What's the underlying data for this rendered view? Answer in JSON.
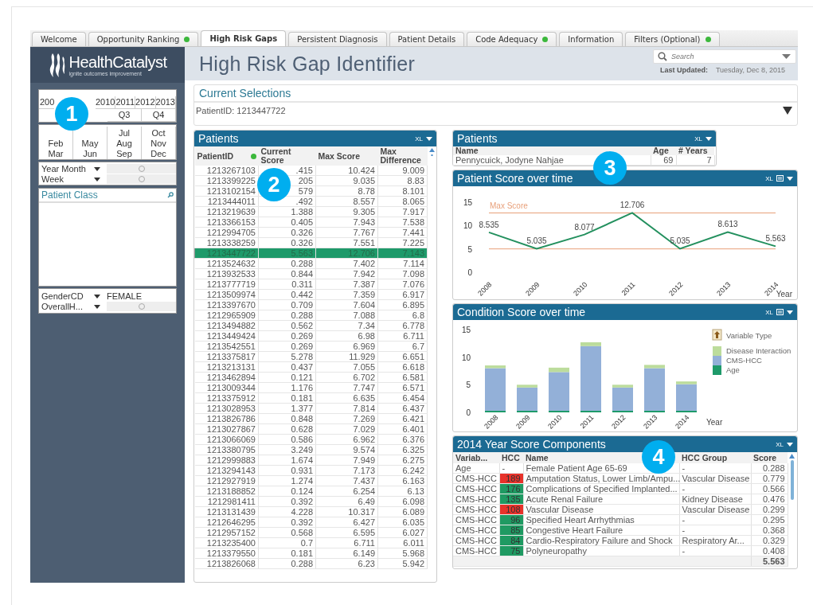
{
  "tabs": [
    {
      "label": "Welcome",
      "selected": false,
      "indicator": false
    },
    {
      "label": "Opportunity Ranking",
      "selected": false,
      "indicator": true
    },
    {
      "label": "High Risk Gaps",
      "selected": true,
      "indicator": false
    },
    {
      "label": "Persistent Diagnosis",
      "selected": false,
      "indicator": false
    },
    {
      "label": "Patient Details",
      "selected": false,
      "indicator": false
    },
    {
      "label": "Code Adequacy",
      "selected": false,
      "indicator": true
    },
    {
      "label": "Information",
      "selected": false,
      "indicator": false
    },
    {
      "label": "Filters (Optional)",
      "selected": false,
      "indicator": true
    }
  ],
  "logo": {
    "name": "HealthCatalyst",
    "tagline": "ignite outcomes improvement"
  },
  "date_filter": {
    "years": [
      "200",
      "2010",
      "2011",
      "2012",
      "2013"
    ],
    "quarters": [
      "Q3",
      "Q4"
    ],
    "month_columns": [
      [
        "Feb",
        "Mar"
      ],
      [
        "May",
        "Jun"
      ],
      [
        "Jul",
        "Aug",
        "Sep"
      ],
      [
        "Oct",
        "Nov",
        "Dec"
      ]
    ]
  },
  "period_fields": [
    {
      "label": "Year Month"
    },
    {
      "label": "Week"
    }
  ],
  "patient_class": {
    "title": "Patient Class"
  },
  "demographic_fields": [
    {
      "label": "GenderCD",
      "value": "FEMALE"
    },
    {
      "label": "OverallH..."
    }
  ],
  "page_title": "High Risk Gap Identifier",
  "search": {
    "placeholder": "Search"
  },
  "last_updated": {
    "label": "Last Updated:",
    "value": "Tuesday, Dec 8, 2015"
  },
  "current_selections": {
    "title": "Current Selections",
    "text": "PatientID: 1213447722"
  },
  "patients_table": {
    "title": "Patients",
    "export": "XL",
    "columns": [
      "PatientID",
      "Current Score",
      "Max Score",
      "Max Difference"
    ],
    "rows": [
      {
        "cells": [
          "1213267103",
          ".415",
          "10.424",
          "9.009"
        ],
        "selected": false
      },
      {
        "cells": [
          "1213399225",
          "205",
          "9.035",
          "8.83"
        ],
        "selected": false
      },
      {
        "cells": [
          "1213102154",
          "579",
          "8.78",
          "8.101"
        ],
        "selected": false
      },
      {
        "cells": [
          "1213444011",
          ".492",
          "8.557",
          "8.065"
        ],
        "selected": false
      },
      {
        "cells": [
          "1213219639",
          "1.388",
          "9.305",
          "7.917"
        ],
        "selected": false
      },
      {
        "cells": [
          "1213366153",
          "0.405",
          "7.943",
          "7.538"
        ],
        "selected": false
      },
      {
        "cells": [
          "1212994705",
          "0.326",
          "7.767",
          "7.441"
        ],
        "selected": false
      },
      {
        "cells": [
          "1213338259",
          "0.326",
          "7.551",
          "7.225"
        ],
        "selected": false
      },
      {
        "cells": [
          "1213447722",
          "5.563",
          "12.706",
          "7.143"
        ],
        "selected": true
      },
      {
        "cells": [
          "1213524632",
          "0.288",
          "7.402",
          "7.114"
        ],
        "selected": false
      },
      {
        "cells": [
          "1213932533",
          "0.844",
          "7.942",
          "7.098"
        ],
        "selected": false
      },
      {
        "cells": [
          "1213777719",
          "0.311",
          "7.387",
          "7.076"
        ],
        "selected": false
      },
      {
        "cells": [
          "1213509974",
          "0.442",
          "7.359",
          "6.917"
        ],
        "selected": false
      },
      {
        "cells": [
          "1213397670",
          "0.709",
          "7.604",
          "6.895"
        ],
        "selected": false
      },
      {
        "cells": [
          "1212965909",
          "0.288",
          "7.088",
          "6.8"
        ],
        "selected": false
      },
      {
        "cells": [
          "1213494882",
          "0.562",
          "7.34",
          "6.778"
        ],
        "selected": false
      },
      {
        "cells": [
          "1213449424",
          "0.269",
          "6.98",
          "6.711"
        ],
        "selected": false
      },
      {
        "cells": [
          "1213542551",
          "0.269",
          "6.969",
          "6.7"
        ],
        "selected": false
      },
      {
        "cells": [
          "1213375817",
          "5.278",
          "11.929",
          "6.651"
        ],
        "selected": false
      },
      {
        "cells": [
          "1213213131",
          "0.437",
          "7.055",
          "6.618"
        ],
        "selected": false
      },
      {
        "cells": [
          "1213462894",
          "0.121",
          "6.702",
          "6.581"
        ],
        "selected": false
      },
      {
        "cells": [
          "1213009344",
          "1.176",
          "7.747",
          "6.571"
        ],
        "selected": false
      },
      {
        "cells": [
          "1213375912",
          "0.181",
          "6.635",
          "6.454"
        ],
        "selected": false
      },
      {
        "cells": [
          "1213028953",
          "1.377",
          "7.814",
          "6.437"
        ],
        "selected": false
      },
      {
        "cells": [
          "1213826786",
          "0.848",
          "7.269",
          "6.421"
        ],
        "selected": false
      },
      {
        "cells": [
          "1213027867",
          "0.628",
          "7.029",
          "6.401"
        ],
        "selected": false
      },
      {
        "cells": [
          "1213066069",
          "0.586",
          "6.962",
          "6.376"
        ],
        "selected": false
      },
      {
        "cells": [
          "1213380795",
          "3.249",
          "9.574",
          "6.325"
        ],
        "selected": false
      },
      {
        "cells": [
          "1212999883",
          "1.674",
          "7.949",
          "6.275"
        ],
        "selected": false
      },
      {
        "cells": [
          "1213294143",
          "0.931",
          "7.173",
          "6.242"
        ],
        "selected": false
      },
      {
        "cells": [
          "1212927919",
          "1.274",
          "7.437",
          "6.163"
        ],
        "selected": false
      },
      {
        "cells": [
          "1213188852",
          "0.124",
          "6.254",
          "6.13"
        ],
        "selected": false
      },
      {
        "cells": [
          "1212981411",
          "0.392",
          "6.49",
          "6.098"
        ],
        "selected": false
      },
      {
        "cells": [
          "1213131439",
          "4.228",
          "10.317",
          "6.089"
        ],
        "selected": false
      },
      {
        "cells": [
          "1212646295",
          "0.392",
          "6.427",
          "6.035"
        ],
        "selected": false
      },
      {
        "cells": [
          "1212957152",
          "0.568",
          "6.595",
          "6.027"
        ],
        "selected": false
      },
      {
        "cells": [
          "1213235400",
          "0.7",
          "6.711",
          "6.011"
        ],
        "selected": false
      },
      {
        "cells": [
          "1213379550",
          "0.181",
          "6.149",
          "5.968"
        ],
        "selected": false
      },
      {
        "cells": [
          "1213826068",
          "0.288",
          "6.23",
          "5.942"
        ],
        "selected": false
      }
    ]
  },
  "patient_info": {
    "title": "Patients",
    "export": "XL",
    "columns": [
      "Name",
      "Age",
      "# Years"
    ],
    "row": [
      "Pennycuick, Jodyne Nahjae",
      "69",
      "7"
    ]
  },
  "patient_score_chart": {
    "title": "Patient Score over time",
    "export": "XL",
    "chart_data": {
      "type": "line",
      "xlabel": "Year",
      "categories": [
        "2008",
        "2009",
        "2010",
        "2011",
        "2012",
        "2013",
        "2014"
      ],
      "series": [
        {
          "color": "#23905e",
          "values": [
            8.535,
            5.035,
            8.077,
            12.706,
            5.035,
            8.613,
            5.563
          ],
          "value_labels": [
            "8.535",
            "5.035",
            "8.077",
            "12.706",
            "5.035",
            "8.613",
            "5.563"
          ]
        },
        {
          "name": "Max Score",
          "color": "#e8a07a",
          "values": [
            12.7,
            12.7,
            12.7,
            12.7,
            12.7,
            12.7,
            12.7
          ]
        },
        {
          "color": "#e8a07a",
          "values": [
            5,
            5,
            5,
            5,
            5,
            5,
            5
          ]
        }
      ],
      "yticks": [
        0,
        5,
        10,
        15
      ],
      "ylim": [
        0,
        15
      ]
    }
  },
  "condition_chart": {
    "title": "Condition Score over time",
    "export": "XL",
    "legend_title": "Variable Type",
    "chart_data": {
      "type": "bar",
      "stacked": true,
      "xlabel": "Year",
      "categories": [
        "2008",
        "2009",
        "2010",
        "2011",
        "2012",
        "2013",
        "2014"
      ],
      "series": [
        {
          "name": "Age",
          "color": "#1e9a6a",
          "values": [
            0.3,
            0.3,
            0.3,
            0.3,
            0.3,
            0.3,
            0.3
          ]
        },
        {
          "name": "CMS-HCC",
          "color": "#93b0d8",
          "values": [
            7.7,
            4.2,
            7.0,
            11.7,
            4.2,
            7.7,
            4.8
          ]
        },
        {
          "name": "Disease Interaction",
          "color": "#bcdc9c",
          "values": [
            0.5,
            0.5,
            0.8,
            0.7,
            0.5,
            0.6,
            0.5
          ]
        }
      ],
      "yticks": [
        0,
        5,
        10,
        15
      ],
      "ylim": [
        0,
        15
      ],
      "legend": "right"
    }
  },
  "score_components": {
    "title": "2014 Year Score Components",
    "export": "XL",
    "columns": [
      "Variab...",
      "HCC",
      "Name",
      "HCC Group",
      "Score"
    ],
    "rows": [
      {
        "cells": [
          "Age",
          "-",
          "Female Patient Age 65-69",
          "-",
          "0.288"
        ]
      },
      {
        "cells": [
          "CMS-HCC",
          "189",
          "Amputation Status, Lower Limb/Ampu...",
          "Vascular Disease",
          "0.779"
        ],
        "color": "#e8322a"
      },
      {
        "cells": [
          "CMS-HCC",
          "176",
          "Complications of Specified Implanted...",
          "-",
          "0.566"
        ],
        "color": "#1f9a62"
      },
      {
        "cells": [
          "CMS-HCC",
          "135",
          "Acute Renal Failure",
          "Kidney Disease",
          "0.476"
        ],
        "color": "#1f9a62"
      },
      {
        "cells": [
          "CMS-HCC",
          "108",
          "Vascular Disease",
          "Vascular Disease",
          "0.299"
        ],
        "color": "#e8322a"
      },
      {
        "cells": [
          "CMS-HCC",
          "96",
          "Specified Heart Arrhythmias",
          "-",
          "0.295"
        ],
        "color": "#1f9a62"
      },
      {
        "cells": [
          "CMS-HCC",
          "85",
          "Congestive Heart Failure",
          "-",
          "0.368"
        ],
        "color": "#1f9a62"
      },
      {
        "cells": [
          "CMS-HCC",
          "84",
          "Cardio-Respiratory Failure  and Shock",
          "Respiratory Ar...",
          "0.329"
        ],
        "color": "#1f9a62"
      },
      {
        "cells": [
          "CMS-HCC",
          "75",
          "Polyneuropathy",
          "-",
          "0.408"
        ],
        "color": "#1f9a62"
      }
    ],
    "total": "5.563"
  },
  "callouts": [
    {
      "label": "1"
    },
    {
      "label": "2"
    },
    {
      "label": "3"
    },
    {
      "label": "4"
    }
  ]
}
